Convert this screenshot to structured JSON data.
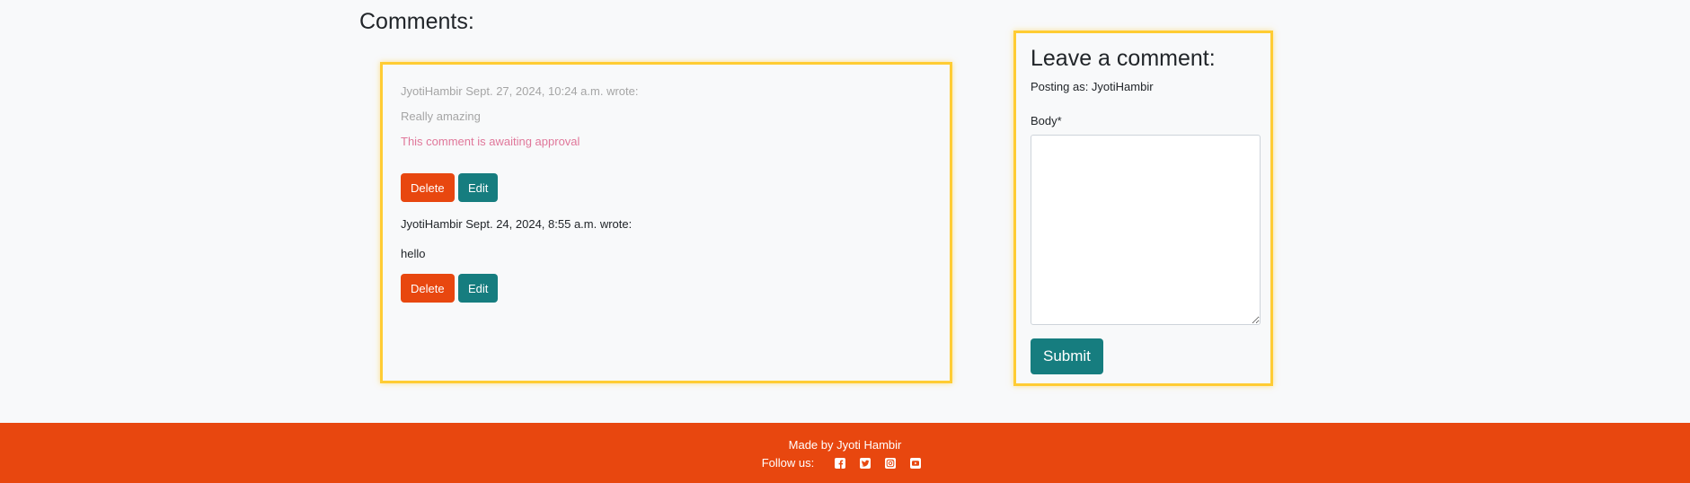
{
  "comments": {
    "title": "Comments:",
    "items": [
      {
        "meta": "JyotiHambir Sept. 27, 2024, 10:24 a.m. wrote:",
        "body": "Really amazing",
        "status": "This comment is awaiting approval",
        "delete_label": "Delete",
        "edit_label": "Edit"
      },
      {
        "meta": "JyotiHambir Sept. 24, 2024, 8:55 a.m. wrote:",
        "body": "hello",
        "delete_label": "Delete",
        "edit_label": "Edit"
      }
    ]
  },
  "form": {
    "title": "Leave a comment:",
    "posting_as": "Posting as: JyotiHambir",
    "body_label": "Body*",
    "body_value": "",
    "submit_label": "Submit"
  },
  "footer": {
    "made_by": "Made by Jyoti Hambir",
    "follow_label": "Follow us:",
    "social_icons": [
      "facebook-icon",
      "twitter-icon",
      "instagram-icon",
      "youtube-icon"
    ]
  },
  "colors": {
    "accent": "#e8470f",
    "teal": "#167d7f",
    "highlight": "#ffcc33"
  }
}
